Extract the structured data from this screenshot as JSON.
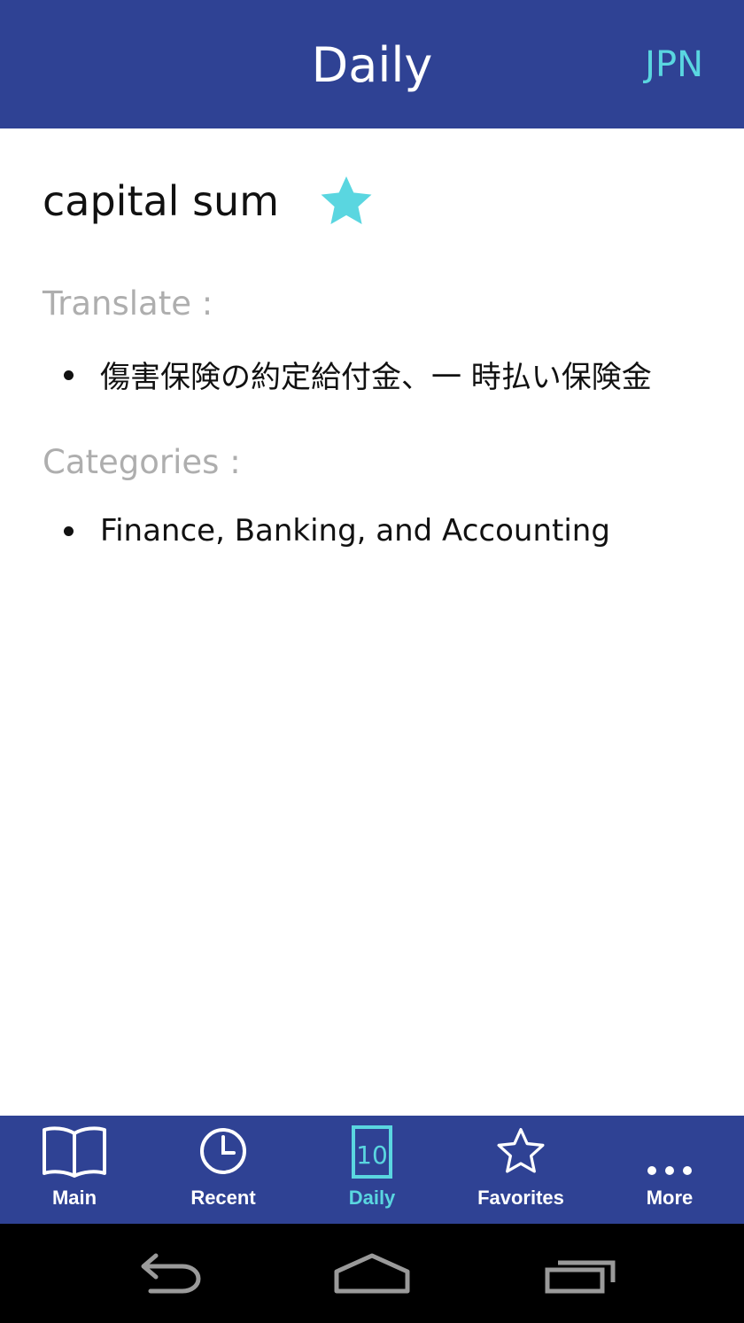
{
  "app_bar": {
    "title": "Daily",
    "language_button": "JPN"
  },
  "entry": {
    "term": "capital sum",
    "favorite": true,
    "translate_label": "Translate :",
    "translations": [
      "傷害保険の約定給付金、一 時払い保険金"
    ],
    "categories_label": "Categories :",
    "categories": [
      "Finance, Banking, and Accounting"
    ]
  },
  "bottom_nav": {
    "items": [
      {
        "label": "Main",
        "icon": "open-book-icon"
      },
      {
        "label": "Recent",
        "icon": "clock-icon"
      },
      {
        "label": "Daily",
        "icon": "calendar-10-icon",
        "active": true
      },
      {
        "label": "Favorites",
        "icon": "star-outline-icon"
      },
      {
        "label": "More",
        "icon": "more-dots-icon"
      }
    ]
  },
  "colors": {
    "primary": "#2f4294",
    "accent": "#5ad6e0",
    "label_gray": "#aeaeae",
    "text": "#111111"
  }
}
